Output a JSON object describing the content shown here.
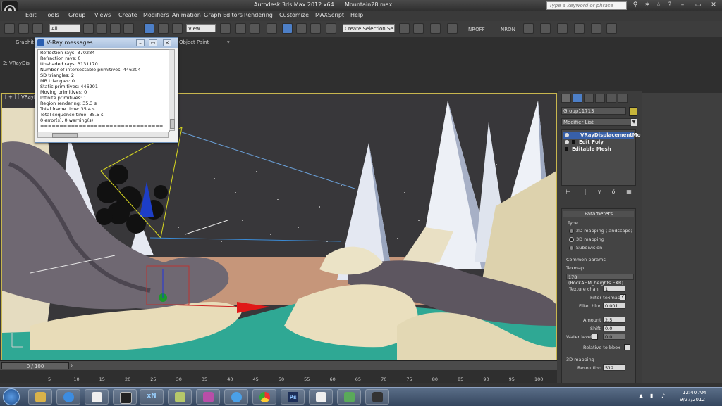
{
  "titlebar": {
    "app_title": "Autodesk 3ds Max  2012 x64",
    "file_name": "Mountain28.max",
    "search_placeholder": "Type a keyword or phrase"
  },
  "menu": {
    "items": [
      "Edit",
      "Tools",
      "Group",
      "Views",
      "Create",
      "Modifiers",
      "Animation",
      "Graph Editors",
      "Rendering",
      "Customize",
      "MAXScript",
      "Help"
    ]
  },
  "toolbar": {
    "filter_select": "All",
    "view_select": "View",
    "selection_set": "Create Selection Se",
    "nroff_label": "NROFF",
    "nron_label": "NRON"
  },
  "ribbon": {
    "tab_graphite": "Graphit",
    "object_paint": "Object Paint",
    "side_label": "2: VRayDis"
  },
  "viewport": {
    "label": "[ + ] [ VRayPh"
  },
  "vray_messages": {
    "title": "V-Ray messages",
    "lines": [
      "Reflection rays: 370284",
      "Refraction rays: 0",
      "Unshaded rays: 3131170",
      "Number of intersectable primitives: 446204",
      "SD triangles: 2",
      "MB triangles: 0",
      "Static primitives: 446201",
      "Moving primitives: 0",
      "Infinite primitives: 1",
      "Region rendering: 35.3 s",
      "Total frame time: 35.4 s",
      "Total sequence time: 35.5 s",
      "0 error(s), 0 warning(s)",
      "================================"
    ]
  },
  "command_panel": {
    "object_name": "Group11713",
    "object_color": "#c7b53a",
    "modifier_list": "Modifier List",
    "stack": [
      "VRayDisplacementMo",
      "Edit Poly",
      "Editable Mesh"
    ],
    "parameters": {
      "header": "Parameters",
      "type_label": "Type",
      "mode_2d": "2D mapping (landscape)",
      "mode_3d": "3D mapping",
      "mode_subdiv": "Subdivision",
      "selected_mode": "3D mapping",
      "common_params": "Common params",
      "texmap_label": "Texmap",
      "texmap_value": "178 (RockAHM_heights.EXR)",
      "texture_chan_label": "Texture chan",
      "texture_chan_value": "1",
      "filter_texmap_label": "Filter texmap",
      "filter_texmap_checked": true,
      "filter_blur_label": "Filter blur",
      "filter_blur_value": "0.001",
      "amount_label": "Amount",
      "amount_value": "2.5",
      "shift_label": "Shift",
      "shift_value": "0.0",
      "water_level_label": "Water level",
      "water_level_value": "0.0",
      "relative_bbox_label": "Relative to bbox",
      "mapping_3d_label": "3D mapping",
      "resolution_label": "Resolution",
      "resolution_value": "512"
    }
  },
  "timeline": {
    "slider_label": "0 / 100",
    "ticks": [
      "5",
      "10",
      "15",
      "20",
      "25",
      "30",
      "35",
      "40",
      "45",
      "50",
      "55",
      "60",
      "65",
      "70",
      "75",
      "80",
      "85",
      "90",
      "95",
      "100"
    ]
  },
  "taskbar": {
    "icons": [
      "explorer-icon",
      "ie-icon",
      "notepad-icon",
      "3dsmax-icon",
      "xnview-icon",
      "winrar-icon",
      "archive-icon",
      "itunes-icon",
      "chrome-icon",
      "photoshop-icon",
      "pose-icon",
      "monitor-icon",
      "media-icon"
    ],
    "xn_text": "xN",
    "ps_text": "Ps",
    "time": "12:40 AM",
    "date": "9/27/2012"
  }
}
